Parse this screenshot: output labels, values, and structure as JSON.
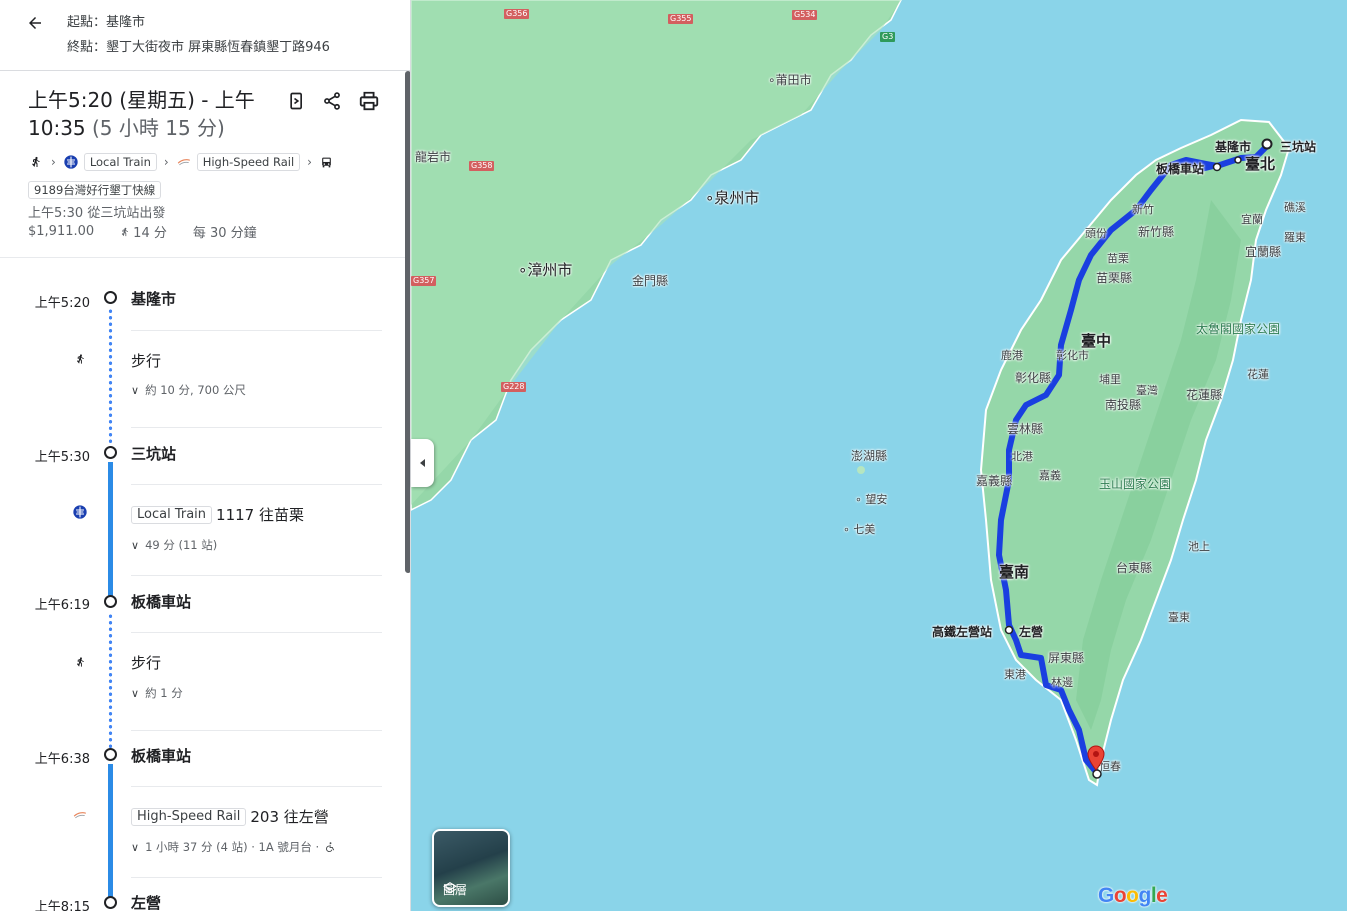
{
  "header": {
    "origin": "起點：基隆市",
    "destination": "終點：墾丁大街夜市 屏東縣恆春鎮墾丁路946"
  },
  "summary": {
    "title_main": "上午5:20 (星期五) - 上午 10:35",
    "title_duration": "(5 小時 15 分)",
    "modes": [
      "Local Train",
      "High-Speed Rail",
      "9189台灣好行墾丁快線"
    ],
    "depart": "上午5:30 從三坑站出發",
    "fare": "$1,911.00",
    "walk": "14 分",
    "frequency": "每 30 分鐘"
  },
  "timeline": {
    "stops": [
      {
        "time": "上午5:20",
        "name": "基隆市"
      },
      {
        "time": "上午5:30",
        "name": "三坑站"
      },
      {
        "time": "上午6:19",
        "name": "板橋車站"
      },
      {
        "time": "上午6:38",
        "name": "板橋車站"
      },
      {
        "time": "上午8:15",
        "name": "左營"
      }
    ],
    "steps": [
      {
        "label": "步行",
        "detail": "約 10 分, 700 公尺"
      },
      {
        "chip": "Local Train",
        "label": "1117 往苗栗",
        "detail": "49 分 (11 站)"
      },
      {
        "label": "步行",
        "detail": "約 1 分"
      },
      {
        "chip": "High-Speed Rail",
        "label": "203 往左營",
        "detail": "1 小時 37 分 (4 站) · 1A 號月台 ·"
      }
    ]
  },
  "map": {
    "labels": {
      "putian": "莆田市",
      "longyan": "龍岩市",
      "quanzhou": "泉州市",
      "zhangzhou": "漳州市",
      "kinmen": "金門縣",
      "penghu": "澎湖縣",
      "wangan": "望安",
      "qimei": "七美",
      "keelung": "基隆市",
      "sankeng": "三坑站",
      "banqiao": "板橋車站",
      "taipei": "臺北",
      "hsinchu_city": "新竹",
      "toufen": "頭份",
      "hsinchu_county": "新竹縣",
      "yilan": "宜蘭",
      "yilan_county": "宜蘭縣",
      "jiaoxi": "礁溪",
      "luodong": "羅東",
      "miaoli": "苗栗",
      "miaoli_county": "苗栗縣",
      "taichung": "臺中",
      "lukang": "鹿港",
      "changhua_city": "彰化市",
      "changhua_county": "彰化縣",
      "taroko": "太魯閣國家公園",
      "puli": "埔里",
      "nantou": "南投縣",
      "taiwan": "臺灣",
      "hualien": "花蓮",
      "hualien_county": "花蓮縣",
      "yunlin": "雲林縣",
      "beigang": "北港",
      "chiayi": "嘉義",
      "chiayi_county": "嘉義縣",
      "yushan": "玉山國家公園",
      "tainan": "臺南",
      "taitung_county": "台東縣",
      "chishang": "池上",
      "zuoying_hsr": "高鐵左營站",
      "zuoying": "左營",
      "pingtung": "屏東縣",
      "donggang": "東港",
      "linbian": "林邊",
      "taitung": "臺東",
      "hengchun": "恒春"
    },
    "roads": [
      "G356",
      "G355",
      "G534",
      "G3",
      "G358",
      "G228",
      "G357"
    ],
    "layers_label": "圖層",
    "logo": "Google",
    "route_color": "#1a3fe0"
  }
}
